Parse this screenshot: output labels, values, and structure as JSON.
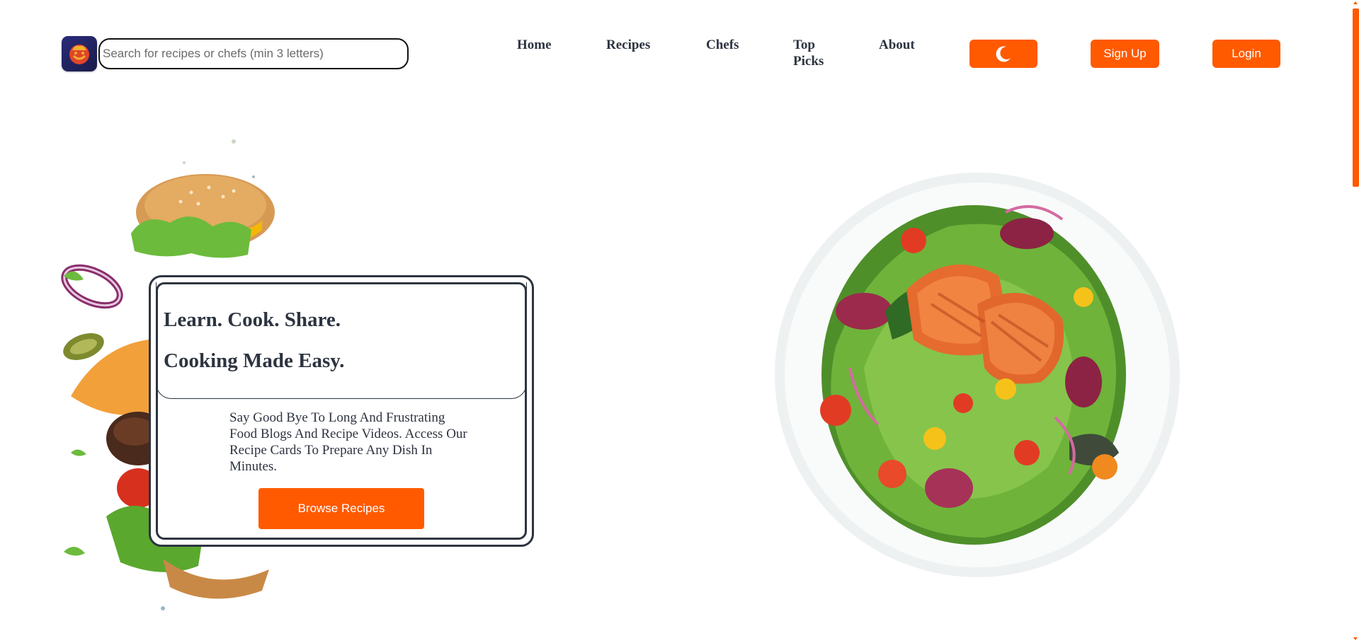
{
  "header": {
    "search": {
      "placeholder": "Search for recipes or chefs (min 3 letters)"
    },
    "nav": [
      {
        "label": "Home"
      },
      {
        "label": "Recipes"
      },
      {
        "label": "Chefs"
      },
      {
        "label": "Top Picks"
      },
      {
        "label": "About"
      }
    ],
    "buttons": {
      "theme_icon": "moon-icon",
      "signup": "Sign Up",
      "login": "Login"
    }
  },
  "hero": {
    "headline_1": "Learn. Cook. Share.",
    "headline_2": "Cooking Made Easy.",
    "description": "Say Good Bye To Long And Frustrating Food Blogs And Recipe Videos. Access Our Recipe Cards To Prepare Any Dish In Minutes.",
    "cta": "Browse Recipes"
  },
  "colors": {
    "accent": "#ff5a00",
    "text": "#2d3440",
    "logo_bg": "#23245f"
  }
}
